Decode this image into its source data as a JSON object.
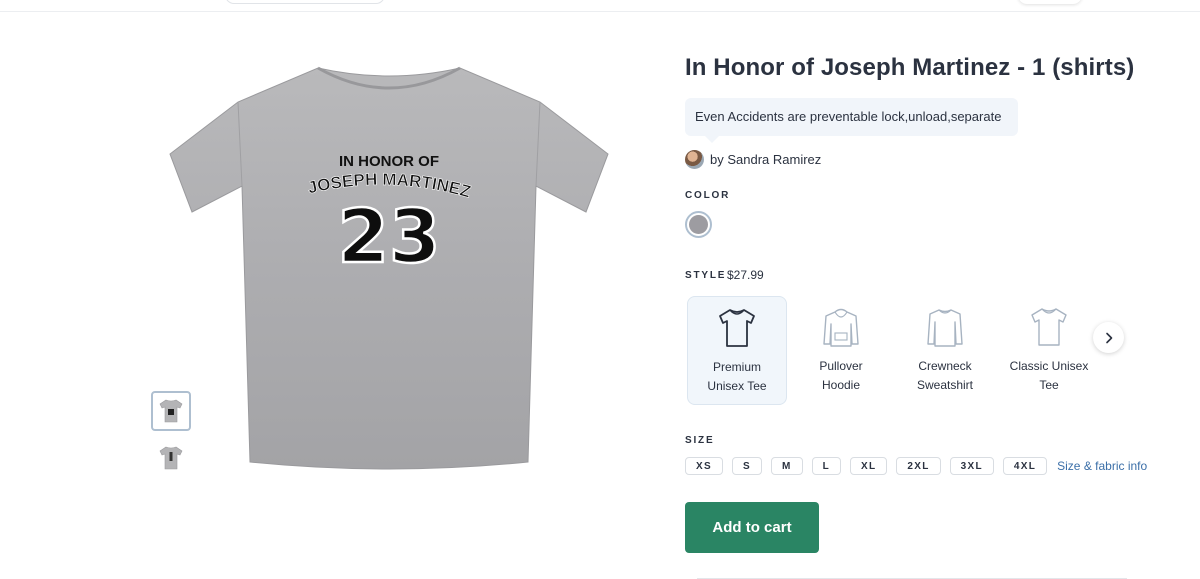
{
  "product": {
    "title": "In Honor of Joseph Martinez - 1 (shirts)",
    "description": "Even Accidents are preventable lock,unload,separate",
    "author": "by Sandra Ramirez",
    "shirt_print": {
      "line1": "IN HONOR OF",
      "line2": "JOSEPH MARTINEZ",
      "number": "23"
    }
  },
  "color": {
    "label": "COLOR",
    "selected_swatch": "#9d9ca1"
  },
  "style": {
    "label": "STYLE",
    "price": "$27.99",
    "options": [
      {
        "line1": "Premium",
        "line2": "Unisex Tee",
        "icon": "tshirt-icon",
        "selected": true
      },
      {
        "line1": "Pullover",
        "line2": "Hoodie",
        "icon": "hoodie-icon",
        "selected": false
      },
      {
        "line1": "Crewneck",
        "line2": "Sweatshirt",
        "icon": "sweatshirt-icon",
        "selected": false
      },
      {
        "line1": "Classic Unisex",
        "line2": "Tee",
        "icon": "tshirt-icon",
        "selected": false
      }
    ],
    "next_icon": "chevron-right-icon"
  },
  "size": {
    "label": "SIZE",
    "options": [
      "XS",
      "S",
      "M",
      "L",
      "XL",
      "2XL",
      "3XL",
      "4XL"
    ],
    "info_link": "Size & fabric info"
  },
  "cart": {
    "button_label": "Add to cart",
    "accent": "#2a8564"
  }
}
